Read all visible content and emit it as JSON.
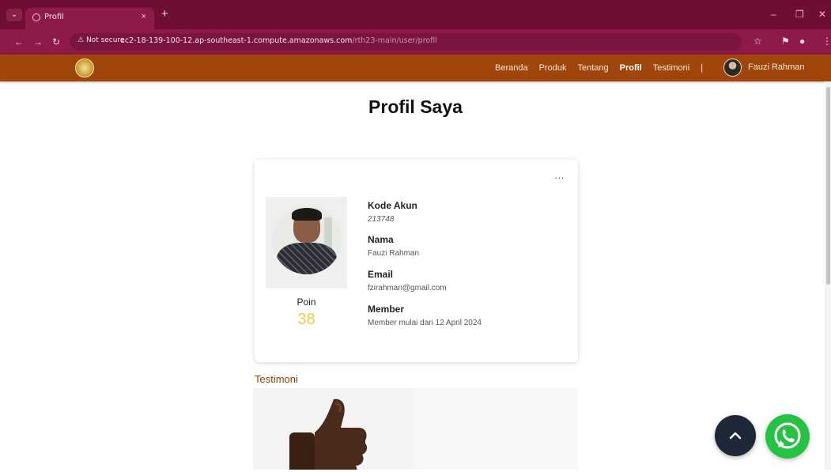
{
  "browser": {
    "tab_title": "Profil",
    "security_label": "Not secure",
    "url_host": "ec2-18-139-100-12.ap-southeast-1.compute.amazonaws.com",
    "url_path": "/rth23-main/user/profil"
  },
  "navbar": {
    "links": [
      "Beranda",
      "Produk",
      "Tentang",
      "Profil",
      "Testimoni"
    ],
    "active_link": "Profil",
    "separator": "|",
    "user_name": "Fauzi Rahman"
  },
  "page": {
    "title": "Profil Saya"
  },
  "profile": {
    "menu": "…",
    "poin_label": "Poin",
    "poin_value": "38",
    "fields": [
      {
        "label": "Kode Akun",
        "value": "213748"
      },
      {
        "label": "Nama",
        "value": "Fauzi Rahman"
      },
      {
        "label": "Email",
        "value": "fzirahman@gmail.com"
      },
      {
        "label": "Member",
        "value": "Member mulai dari 12 April 2024"
      }
    ]
  },
  "testimoni": {
    "label": "Testimoni"
  },
  "floating": {
    "scroll_top_icon": "chevron-up-icon",
    "whatsapp_icon": "whatsapp-icon"
  },
  "colors": {
    "navbar": "#a0450b",
    "browser_frame": "#6e0e34",
    "poin": "#f2c84b",
    "whatsapp": "#25c244"
  }
}
